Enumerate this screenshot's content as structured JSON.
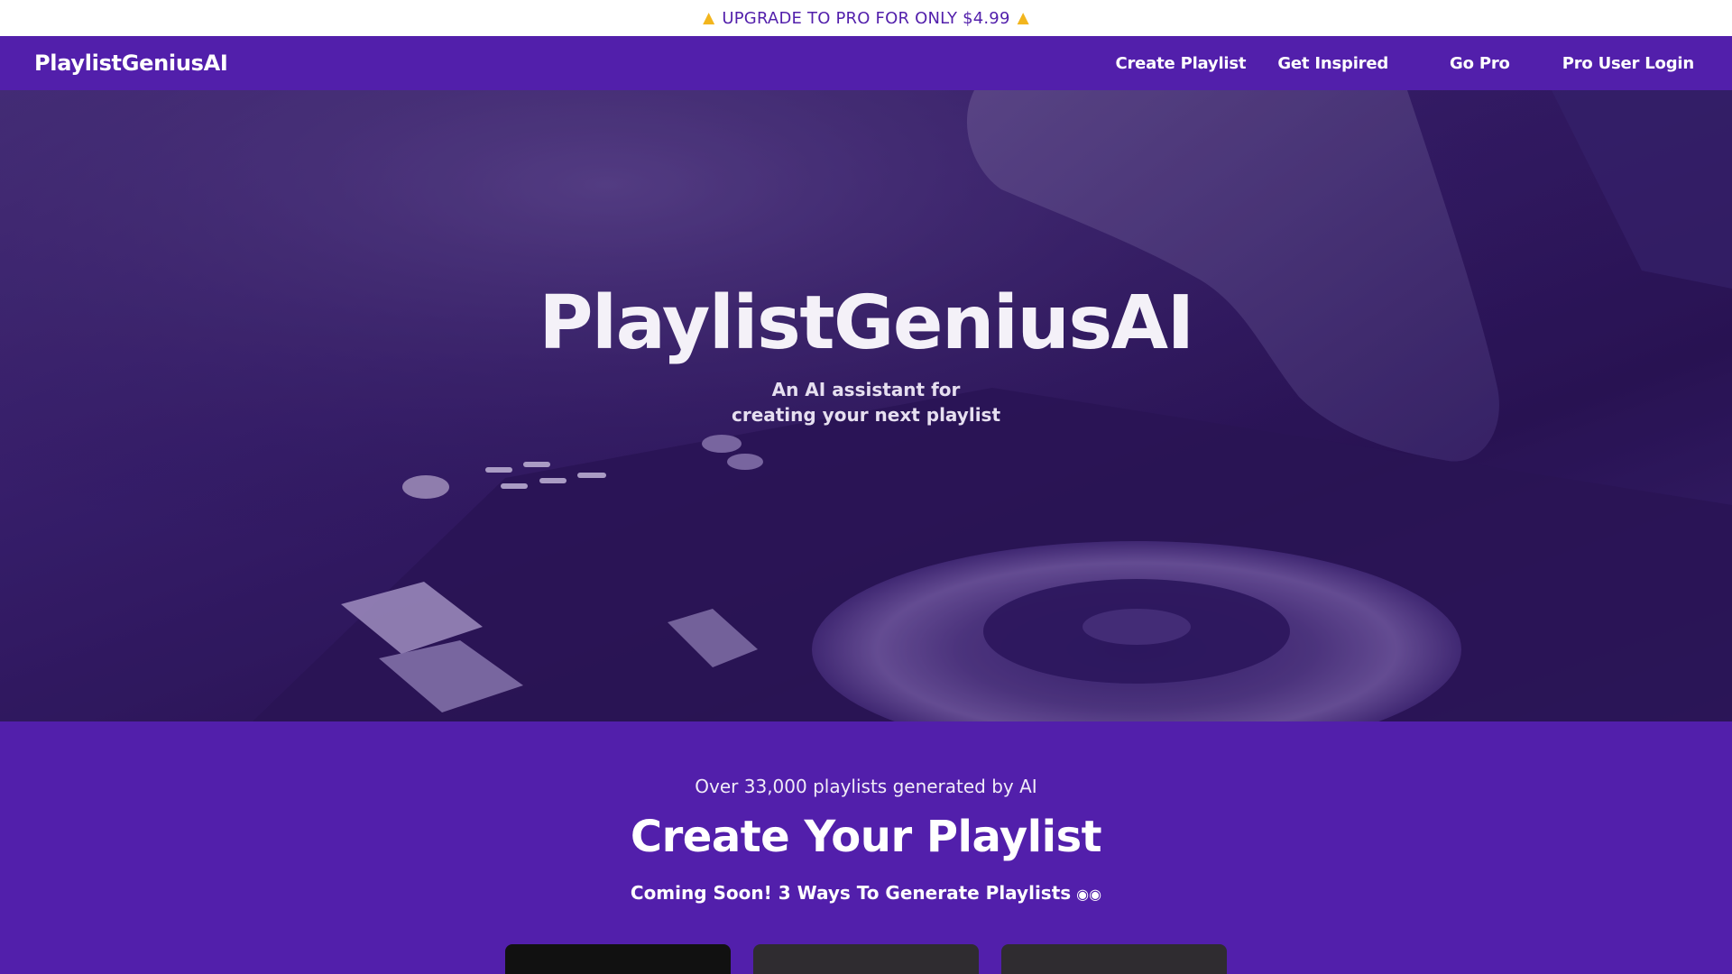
{
  "promo": {
    "icon_left": "megaphone-icon",
    "text": "UPGRADE TO PRO FOR ONLY $4.99",
    "icon_right": "megaphone-icon"
  },
  "nav": {
    "brand": "PlaylistGeniusAI",
    "links": [
      "Create Playlist",
      "Get Inspired",
      "Go Pro",
      "Pro User Login"
    ]
  },
  "hero": {
    "title": "PlaylistGeniusAI",
    "subtitle_line1": "An AI assistant for",
    "subtitle_line2": "creating your next playlist",
    "background": "dj-mixer-photo"
  },
  "create": {
    "stat": "Over 33,000 playlists generated by AI",
    "title": "Create Your Playlist",
    "coming_soon": "Coming Soon! 3 Ways To Generate Playlists",
    "coming_soon_icon": "eyes-icon"
  },
  "colors": {
    "brand_purple": "#521fab",
    "promo_bg": "#ffffff",
    "card_dark": "#111111",
    "card_grey": "#2f2c30"
  }
}
